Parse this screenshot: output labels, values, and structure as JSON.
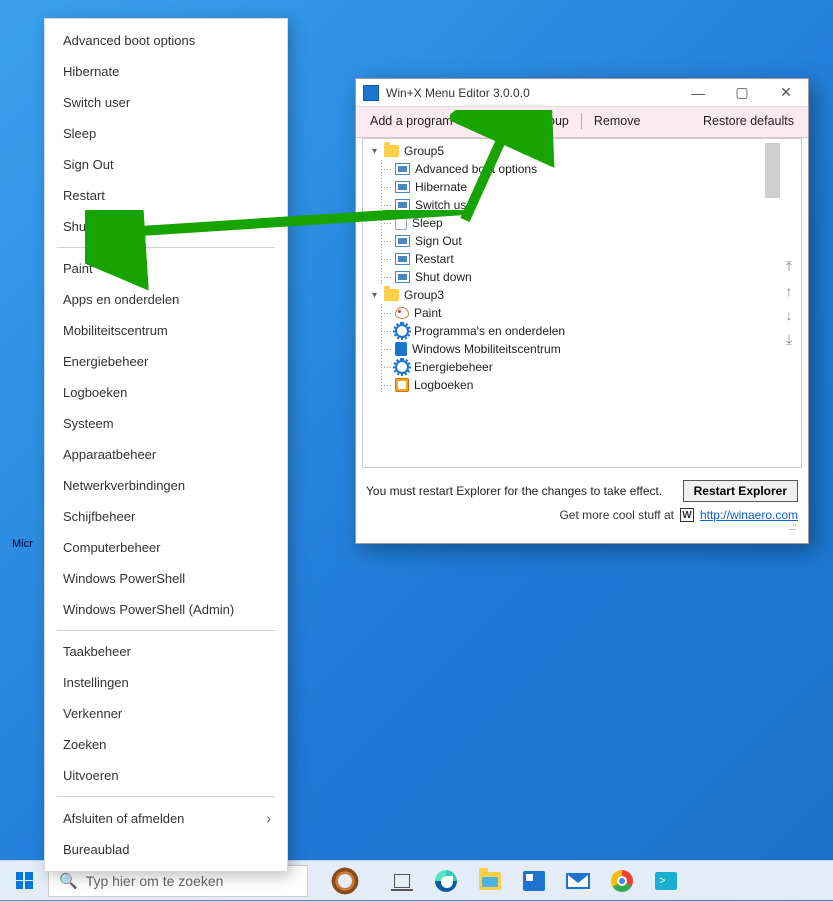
{
  "desktop_label": "Micr",
  "winx": {
    "groups": [
      {
        "items": [
          "Advanced boot options",
          "Hibernate",
          "Switch user",
          "Sleep",
          "Sign Out",
          "Restart",
          "Shut down"
        ]
      },
      {
        "items": [
          "Paint",
          "Apps en onderdelen",
          "Mobiliteitscentrum",
          "Energiebeheer",
          "Logboeken",
          "Systeem",
          "Apparaatbeheer",
          "Netwerkverbindingen",
          "Schijfbeheer",
          "Computerbeheer",
          "Windows PowerShell",
          "Windows PowerShell (Admin)"
        ]
      },
      {
        "items": [
          "Taakbeheer",
          "Instellingen",
          "Verkenner",
          "Zoeken",
          "Uitvoeren"
        ]
      },
      {
        "items_sub": [
          {
            "label": "Afsluiten of afmelden",
            "submenu": true
          },
          {
            "label": "Bureaublad",
            "submenu": false
          }
        ]
      }
    ]
  },
  "editor": {
    "title": "Win+X Menu Editor 3.0.0.0",
    "toolbar": {
      "add": "Add a program",
      "create": "Create a group",
      "remove": "Remove",
      "restore": "Restore defaults"
    },
    "tree": [
      {
        "type": "group",
        "label": "Group5"
      },
      {
        "type": "child",
        "icon": "win",
        "label": "Advanced boot options"
      },
      {
        "type": "child",
        "icon": "win",
        "label": "Hibernate"
      },
      {
        "type": "child",
        "icon": "win",
        "label": "Switch user"
      },
      {
        "type": "child",
        "icon": "doc",
        "label": "Sleep"
      },
      {
        "type": "child",
        "icon": "win",
        "label": "Sign Out"
      },
      {
        "type": "child",
        "icon": "win",
        "label": "Restart"
      },
      {
        "type": "child",
        "icon": "win",
        "label": "Shut down"
      },
      {
        "type": "group",
        "label": "Group3"
      },
      {
        "type": "child",
        "icon": "paint",
        "label": "Paint"
      },
      {
        "type": "child",
        "icon": "gear",
        "label": "Programma's en onderdelen"
      },
      {
        "type": "child",
        "icon": "mob",
        "label": "Windows Mobiliteitscentrum"
      },
      {
        "type": "child",
        "icon": "gear",
        "label": "Energiebeheer"
      },
      {
        "type": "child",
        "icon": "log",
        "label": "Logboeken"
      }
    ],
    "footer": {
      "note": "You must restart Explorer for the changes to take effect.",
      "restart": "Restart Explorer",
      "linkpre": "Get more cool stuff at",
      "linktxt": "http://winaero.com"
    }
  },
  "taskbar": {
    "search_placeholder": "Typ hier om te zoeken"
  }
}
